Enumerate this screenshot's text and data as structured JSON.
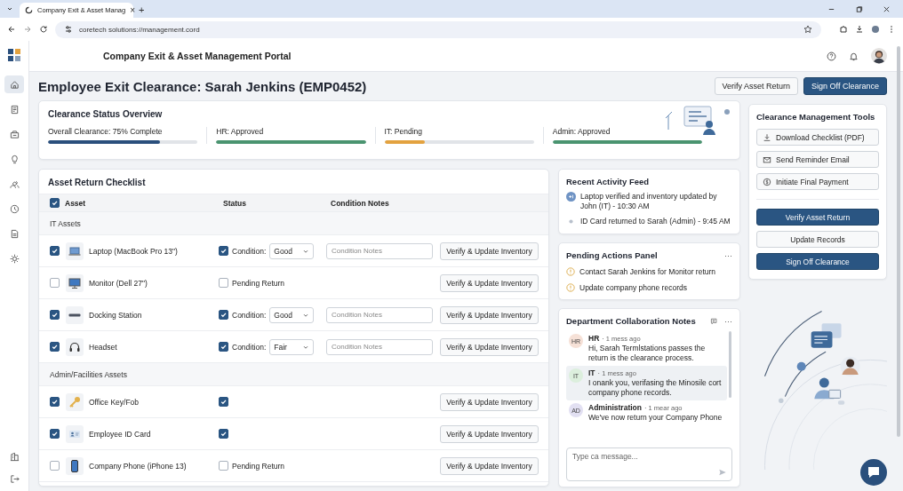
{
  "browser": {
    "tab_title": "Company Exit & Asset Manag",
    "tab_close": "×",
    "new_tab": "+",
    "url": "coretech solutions://management.cord"
  },
  "sidebar": {
    "items": [
      {
        "selected": true
      },
      {
        "selected": false
      },
      {
        "selected": false
      },
      {
        "selected": false
      },
      {
        "selected": false
      },
      {
        "selected": false
      },
      {
        "selected": false
      },
      {
        "selected": false
      }
    ]
  },
  "header": {
    "title": "Company Exit & Asset Management Portal"
  },
  "page": {
    "title": "Employee Exit Clearance: Sarah Jenkins (EMP0452)",
    "buttons": [
      {
        "label": "Verify Asset Return",
        "kind": "outline"
      },
      {
        "label": "Sign Off Clearance",
        "kind": "primary"
      }
    ]
  },
  "status_overview": {
    "title": "Clearance Status Overview",
    "items": [
      {
        "label": "Overall Clearance: 75% Complete",
        "level": 0.75,
        "color": "#2a4f7c"
      },
      {
        "label": "HR: Approved",
        "level": 1,
        "color": "#4a9470"
      },
      {
        "label": "IT: Pending",
        "level": 0.27,
        "color": "#e3a23f"
      },
      {
        "label": "Admin: Approved",
        "level": 1,
        "color": "#4a9470"
      }
    ]
  },
  "checklist": {
    "title": "Asset Return Checklist",
    "all_checked": true,
    "columns": [
      "Asset",
      "Status",
      "Condition Notes"
    ],
    "groups": [
      {
        "name": "IT Assets",
        "rows": [
          {
            "asset": "Laptop (MacBook Pro 13\")",
            "checked": true,
            "kind": "condition",
            "status_checked": true,
            "status_label": "Condition:",
            "condition": "Good",
            "notes_placeholder": "Condition Notes",
            "action": "Verify & Update Inventory"
          },
          {
            "asset": "Monitor (Dell 27\")",
            "checked": false,
            "kind": "pending",
            "status_checked": false,
            "status_label": "Pending Return",
            "action": "Verify & Update Inventory"
          },
          {
            "asset": "Docking Station",
            "checked": true,
            "kind": "condition",
            "status_checked": true,
            "status_label": "Condition:",
            "condition": "Good",
            "notes_placeholder": "Condition Notes",
            "action": "Verify & Update Inventory"
          },
          {
            "asset": "Headset",
            "checked": true,
            "kind": "condition",
            "status_checked": true,
            "status_label": "Condition:",
            "condition": "Fair",
            "notes_placeholder": "Condition Notes",
            "action": "Verify & Update Inventory"
          }
        ]
      },
      {
        "name": "Admin/Facilities Assets",
        "rows": [
          {
            "asset": "Office Key/Fob",
            "checked": true,
            "kind": "plain",
            "status_checked": true,
            "action": "Verify & Update Inventory"
          },
          {
            "asset": "Employee ID Card",
            "checked": true,
            "kind": "plain",
            "status_checked": true,
            "action": "Verify & Update Inventory"
          },
          {
            "asset": "Company Phone (iPhone 13)",
            "checked": false,
            "kind": "pending",
            "status_checked": false,
            "status_label": "Pending Return",
            "action": "Verify & Update Inventory"
          }
        ]
      }
    ]
  },
  "activity": {
    "title": "Recent Activity Feed",
    "items": [
      {
        "kind": "badge",
        "text": "Laptop verified and inventory updated by John (IT) - 10:30 AM"
      },
      {
        "kind": "dot",
        "text": "ID Card returned to Sarah (Admin) - 9:45 AM"
      }
    ]
  },
  "pending": {
    "title": "Pending Actions Panel",
    "more": "···",
    "items": [
      {
        "text": "Contact Sarah Jenkins for Monitor return"
      },
      {
        "text": "Update company phone records"
      }
    ]
  },
  "notes": {
    "title": "Department Collaboration Notes",
    "more": "···",
    "messages": [
      {
        "initials": "HR",
        "author": "HR",
        "time": "· 1 mess ago",
        "text": "Hi, Sarah Termlstations passes the return is the clearance process.",
        "color": "#f6e1d7",
        "selected": false
      },
      {
        "initials": "IT",
        "author": "IT",
        "time": "· 1 mess ago",
        "text": "I onank you, verifasing the Minosile cort company phone records.",
        "color": "#dcefdd",
        "selected": true
      },
      {
        "initials": "AD",
        "author": "Administration",
        "time": "· 1 mear ago",
        "text": "We've now return your Company Phone",
        "color": "#e2e0f2",
        "selected": false
      }
    ],
    "placeholder": "Type ca message..."
  },
  "tools": {
    "title": "Clearance Management Tools",
    "buttons": [
      {
        "label": "Download Checklist (PDF)",
        "kind": "download"
      },
      {
        "label": "Send Reminder Email",
        "kind": "mail"
      },
      {
        "label": "Initiate Final Payment",
        "kind": "payment"
      },
      {
        "label": "Verify Asset Return",
        "kind": "primary"
      },
      {
        "label": "Update Records",
        "kind": "outline"
      },
      {
        "label": "Sign Off Clearance",
        "kind": "primary"
      }
    ]
  }
}
